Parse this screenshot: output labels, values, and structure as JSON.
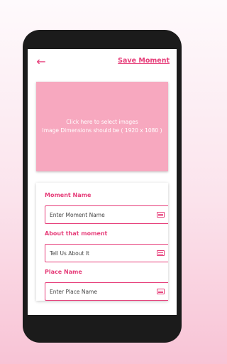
{
  "toolbar": {
    "back_icon": "arrow-left-icon",
    "save_label": "Save Moment"
  },
  "image_picker": {
    "line1": "Click here to select images",
    "line2": "Image Dimensions should be ( 1920 x 1080 )"
  },
  "form": {
    "moment_name": {
      "label": "Moment Name",
      "placeholder": "Enter Moment Name"
    },
    "about": {
      "label": "About that moment",
      "placeholder": "Tell Us About It"
    },
    "place": {
      "label": "Place Name",
      "placeholder": "Enter Place Name"
    }
  },
  "colors": {
    "accent": "#e63d79",
    "picker_bg": "#f7a8bf",
    "phone_frame": "#1b1b1b"
  }
}
